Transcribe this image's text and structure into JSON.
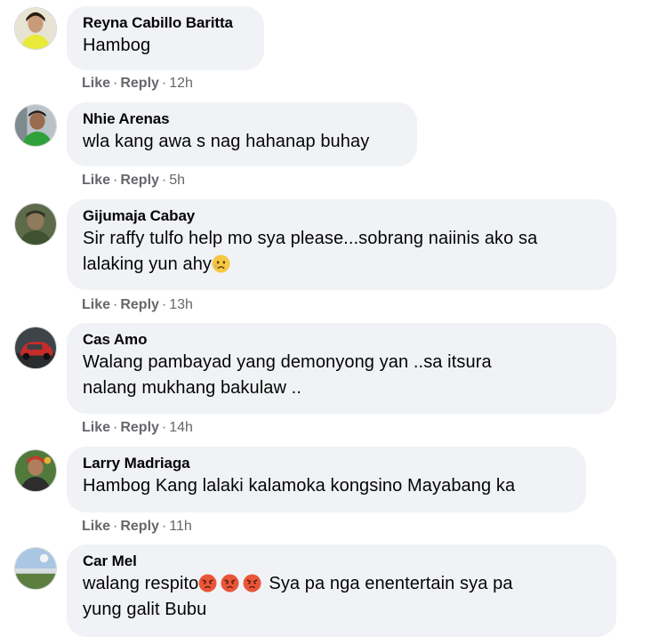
{
  "comments": [
    {
      "author": "Reyna Cabillo Baritta",
      "lines": [
        "Hambog"
      ],
      "like_label": "Like",
      "reply_label": "Reply",
      "time": "12h"
    },
    {
      "author": "Nhie Arenas",
      "lines": [
        "wla kang awa s nag hahanap buhay"
      ],
      "like_label": "Like",
      "reply_label": "Reply",
      "time": "5h"
    },
    {
      "author": "Gijumaja Cabay",
      "lines": [
        "Sir raffy tulfo help mo sya please...sobrang naiinis ako sa",
        "lalaking yun ahy"
      ],
      "emoji": "crying-face",
      "like_label": "Like",
      "reply_label": "Reply",
      "time": "13h"
    },
    {
      "author": "Cas Amo",
      "lines": [
        "Walang pambayad yang demonyong yan ..sa itsura",
        "nalang mukhang bakulaw .."
      ],
      "like_label": "Like",
      "reply_label": "Reply",
      "time": "14h"
    },
    {
      "author": "Larry Madriaga",
      "lines": [
        "Hambog Kang lalaki kalamoka kongsino Mayabang ka"
      ],
      "like_label": "Like",
      "reply_label": "Reply",
      "time": "11h"
    },
    {
      "author": "Car Mel",
      "lines": [
        "walang respito",
        "Sya pa nga enentertain sya pa",
        "yung galit Bubu"
      ],
      "emoji": "angry-face",
      "like_label": "Like",
      "reply_label": "Reply",
      "time": ""
    }
  ],
  "separator": "·"
}
